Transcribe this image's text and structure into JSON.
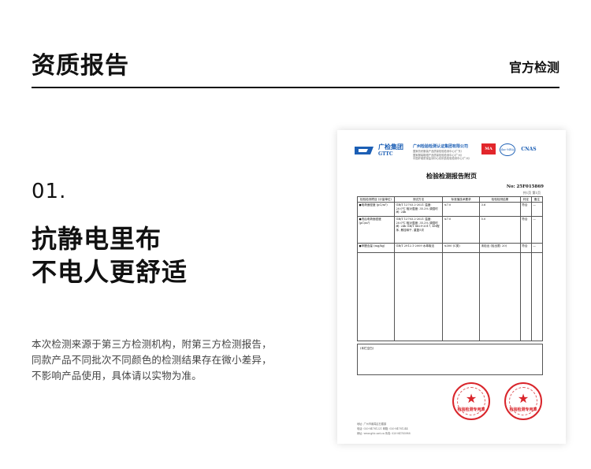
{
  "header": {
    "title": "资质报告",
    "subtitle": "官方检测"
  },
  "section": {
    "number": "01.",
    "headline_lines": [
      "抗静电里布",
      "不电人更舒适"
    ],
    "description_lines": [
      "本次检测来源于第三方检测机构，附第三方检测报告，",
      "同款产品不同批次不同颜色的检测结果存在微小差异，",
      "不影响产品使用，具体请以实物为准。"
    ]
  },
  "certificate": {
    "logo_name": "广检集团",
    "logo_en": "GTTC",
    "org_name": "广州检验检测认证集团有限公司",
    "org_lines": [
      "国家纺织服装产品质量检验检测中心(广东)",
      "国家服装鞋帽产品质量检验检测中心(广州)",
      "中国纤维质量监测中心纺织品检验检测中心(广州)"
    ],
    "badges": [
      "MA",
      "ilac-MRA",
      "CNAS"
    ],
    "title": "检验检测报告附页",
    "report_no": "No: 25F015869",
    "page_info": "共1页 第1页",
    "table_headers": [
      "检验检测项目 (计量单位)",
      "测试方法",
      "标准值技术要求",
      "检验检测结果",
      "判定",
      "备注"
    ],
    "rows": [
      [
        "●电荷面密度 (μC/m²)",
        "GB/T 12703.2-2021 温度: 20.0℃ 相对湿度: 35.2% 调湿时间: 24h",
        "≤7.0",
        "3.6",
        "符合",
        "—"
      ],
      [
        "●洗后电荷面密度 (μC/m²)",
        "GB/T 12703.2-2021 温度: 20.0℃ 相对湿度: 35.2% 调湿时间: 24h GB/T 8629-2017, 4N程序, 悬挂晾干, 重复5次",
        "≤7.0",
        "5.0",
        "符合",
        "—"
      ],
      [
        "●甲醛含量 (mg/kg)",
        "GB/T 2912.1-2009 水萃取法",
        "≤300 (C类)",
        "未检出 (检出限: 20)",
        "符合",
        "—"
      ]
    ],
    "blank_label": "(本栏空白)",
    "stamp_text": "检验检测专用章",
    "footer_lines": [
      "地址: 广州市番禺区石楼镇",
      "电话: 020-84781221  邮箱: 020-84781244",
      "网址: www.gttc.net.cn  传真: 020-84783988"
    ]
  }
}
